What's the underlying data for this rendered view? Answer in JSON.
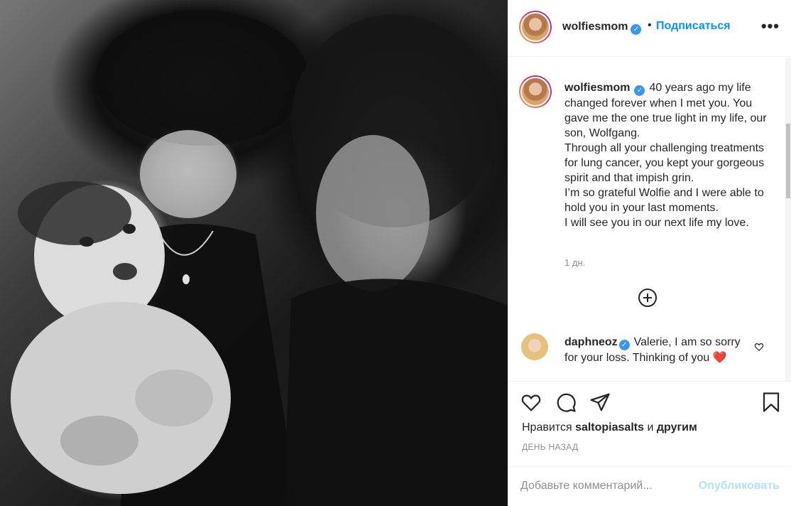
{
  "post": {
    "image_alt": "Black and white family photo",
    "header": {
      "username": "wolfiesmom",
      "verified_mark": "✓",
      "separator": "•",
      "follow_label": "Подписаться",
      "more_label": "•••"
    },
    "caption": {
      "username": "wolfiesmom",
      "text": "40 years ago my life changed forever when I met you. You gave me the one true light in my life, our son, Wolfgang.\nThrough all your challenging treatments for lung cancer, you kept your gorgeous spirit and that impish grin.\nI’m so grateful Wolfie and I were able to hold you in your last moments.\nI will see you in our next life my love.",
      "time": "1 дн."
    },
    "comments": [
      {
        "username": "daphneoz",
        "text": "Valerie, I am so sorry for your loss. Thinking of you",
        "emoji": "❤️"
      }
    ],
    "likes": {
      "prefix": "Нравится",
      "user": "saltopiasalts",
      "conjunction": "и",
      "others": "другим"
    },
    "date": "ДЕНЬ НАЗАД",
    "comment_box": {
      "placeholder": "Добавьте комментарий...",
      "publish_label": "Опубликовать"
    },
    "icons": {
      "like": "heart-icon",
      "comment": "comment-icon",
      "share": "share-icon",
      "save": "bookmark-icon",
      "load_more": "plus-circle-icon"
    },
    "colors": {
      "accent": "#0095f6",
      "publish_disabled": "#b2dffc",
      "verified": "#3897f0",
      "heart": "#ed4956"
    }
  }
}
